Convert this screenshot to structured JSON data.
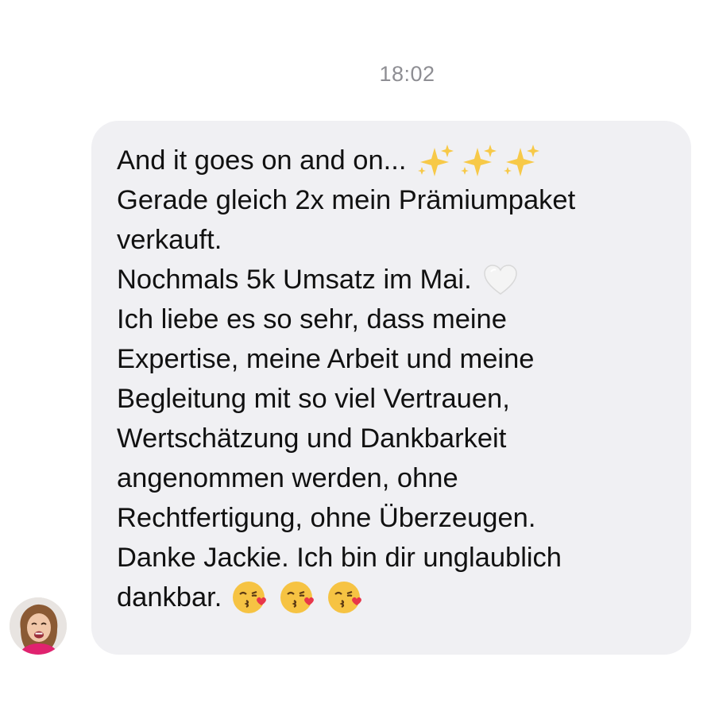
{
  "timestamp": "18:02",
  "message": {
    "lines": [
      "And it goes on and on...",
      "Gerade gleich 2x mein Prämiumpaket",
      "verkauft.",
      "Nochmals 5k Umsatz im Mai.",
      "Ich liebe es so sehr, dass meine",
      "Expertise, meine Arbeit und meine",
      "Begleitung mit so viel Vertrauen,",
      "Wertschätzung und Dankbarkeit",
      "angenommen werden, ohne",
      "Rechtfertigung, ohne Überzeugen.",
      "Danke Jackie. Ich bin dir unglaublich",
      "dankbar."
    ],
    "emojis": {
      "line1": [
        "sparkles-icon",
        "sparkles-icon",
        "sparkles-icon"
      ],
      "line4": [
        "white-heart-icon"
      ],
      "line12": [
        "kissing-heart-icon",
        "kissing-heart-icon",
        "kissing-heart-icon"
      ]
    }
  },
  "sender": {
    "avatar_icon": "avatar-photo"
  },
  "colors": {
    "bubble_background": "#f0f0f3",
    "timestamp": "#8e8e93",
    "text": "#111111"
  }
}
